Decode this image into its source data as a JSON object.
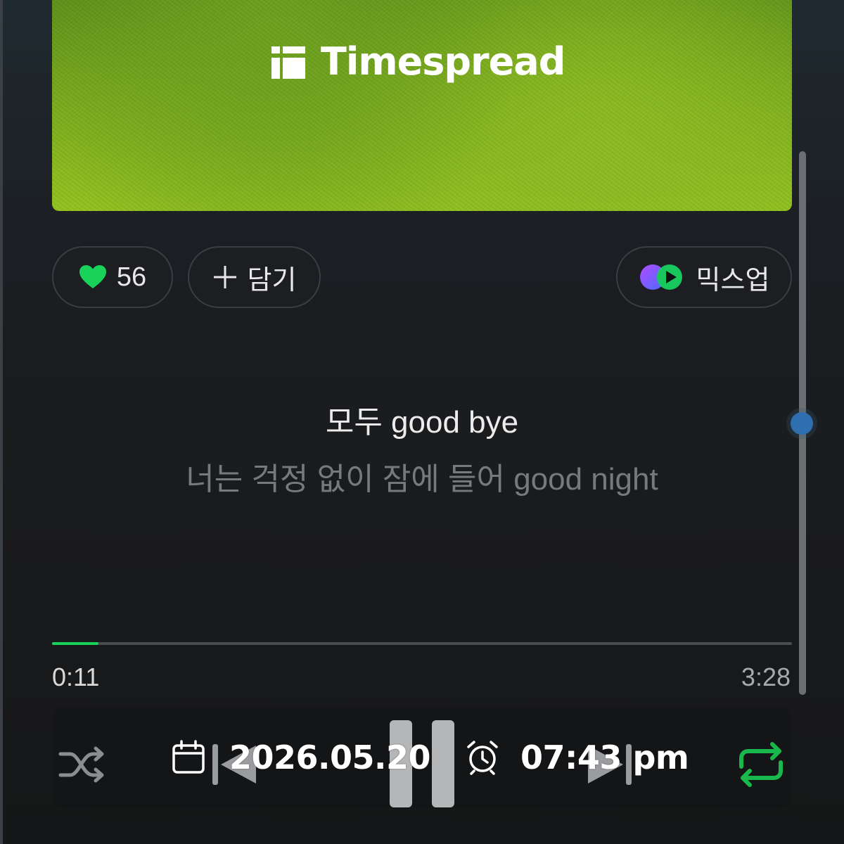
{
  "album": {
    "brand_name": "Timespread"
  },
  "actions": {
    "like_count": "56",
    "add_label": "담기",
    "mixup_label": "믹스업"
  },
  "lyrics": {
    "current": "모두 good bye",
    "next": "너는 걱정 없이 잠에 들어 good night"
  },
  "playback": {
    "current_time": "0:11",
    "total_time": "3:28",
    "progress_fraction": 0.063
  },
  "overlay": {
    "date": "2026.05.20",
    "time": "07:43 pm"
  },
  "icons": {
    "like": "heart-icon",
    "add": "plus-icon",
    "mixup": "mixup-icon",
    "shuffle": "shuffle-icon",
    "previous": "previous-icon",
    "pause": "pause-icon",
    "next": "next-icon",
    "repeat": "repeat-icon",
    "calendar": "calendar-icon",
    "clock": "alarm-clock-icon"
  },
  "colors": {
    "accent_green": "#18d25a",
    "scroll_thumb": "#2f6fb0"
  }
}
